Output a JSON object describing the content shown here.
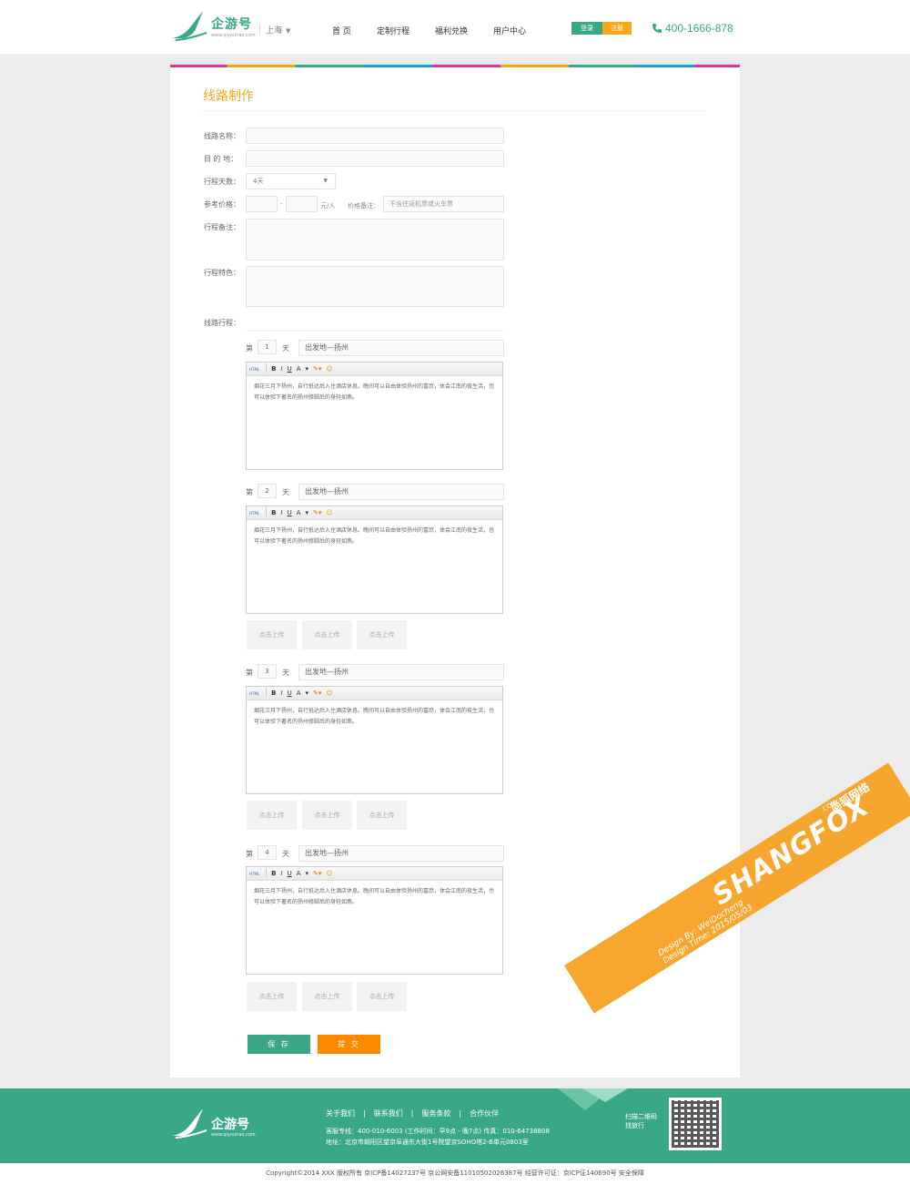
{
  "header": {
    "logo_text": "企游号",
    "logo_sub": "www.qiyouhao.com",
    "city": "上海",
    "nav": [
      "首 页",
      "定制行程",
      "福利兑换",
      "用户中心"
    ],
    "login": "登录",
    "register": "注册",
    "phone": "400-1666-878"
  },
  "form": {
    "page_title": "线路制作",
    "labels": {
      "route_name": "线路名称：",
      "destination": "目 的 地：",
      "days": "行程天数：",
      "price": "参考价格：",
      "price_dash": "-",
      "price_unit": "元/人",
      "price_note_label": "价格备注：",
      "remark": "行程备注：",
      "feature": "行程特色：",
      "itinerary": "线路行程："
    },
    "days_value": "4天",
    "price_note_placeholder": "不含往返机票或火车票"
  },
  "days": [
    {
      "prefix": "第",
      "num": "1",
      "suffix": "天",
      "title": "出发地—扬州",
      "content": "烟花三月下扬州，自行抵达后入住酒店休息。晚间可以自由体验扬州的富庶，体会江南的夜生活，也可以体验下著名的扬州修脚后的身轻如燕。"
    },
    {
      "prefix": "第",
      "num": "2",
      "suffix": "天",
      "title": "出发地—扬州",
      "content": "烟花三月下扬州，自行抵达后入住酒店休息。晚间可以自由体验扬州的富庶，体会江南的夜生活，也可以体验下著名的扬州修脚后的身轻如燕。"
    },
    {
      "prefix": "第",
      "num": "3",
      "suffix": "天",
      "title": "出发地—扬州",
      "content": "烟花三月下扬州，自行抵达后入住酒店休息。晚间可以自由体验扬州的富庶，体会江南的夜生活，也可以体验下著名的扬州修脚后的身轻如燕。"
    },
    {
      "prefix": "第",
      "num": "4",
      "suffix": "天",
      "title": "出发地—扬州",
      "content": "烟花三月下扬州，自行抵达后入住酒店休息。晚间可以自由体验扬州的富庶，体会江南的夜生活，也可以体验下著名的扬州修脚后的身轻如燕。"
    }
  ],
  "editor_toolbar": {
    "html": "HTML",
    "bold": "B",
    "italic": "I",
    "underline": "U",
    "font_color": "A"
  },
  "upload_label": "点击上传",
  "buttons": {
    "save": "保 存",
    "submit": "提 交"
  },
  "footer": {
    "links": [
      "关于我们",
      "联系我们",
      "服务条款",
      "合作伙伴"
    ],
    "link_sep": "|",
    "hotline": "客服专线：400-010-6003 (工作时间：早9点 - 晚7点) 传真：010-64738808",
    "address": "地址：北京市朝阳区望京阜通东大街1号院望京SOHO塔2-B单元0803室",
    "qr_label_1": "扫描二维码",
    "qr_label_2": "找旅行",
    "copyright": "Copyright©2014    XXX    版权所有    京ICP备14027237号    京公网安备11010502026387号    经营许可证：京ICP证140690号    安全保障"
  },
  "watermark": {
    "brand": "SHANGFOX",
    "brand_cn": "尚狐网络",
    "com": ".COM",
    "design_by": "Design By: WeiDocheng",
    "design_time": "Design Time: 2015/05/03"
  },
  "colors": {
    "brand_green": "#3aa787",
    "accent_orange": "#f7a81a",
    "submit_orange": "#fb8a00"
  }
}
